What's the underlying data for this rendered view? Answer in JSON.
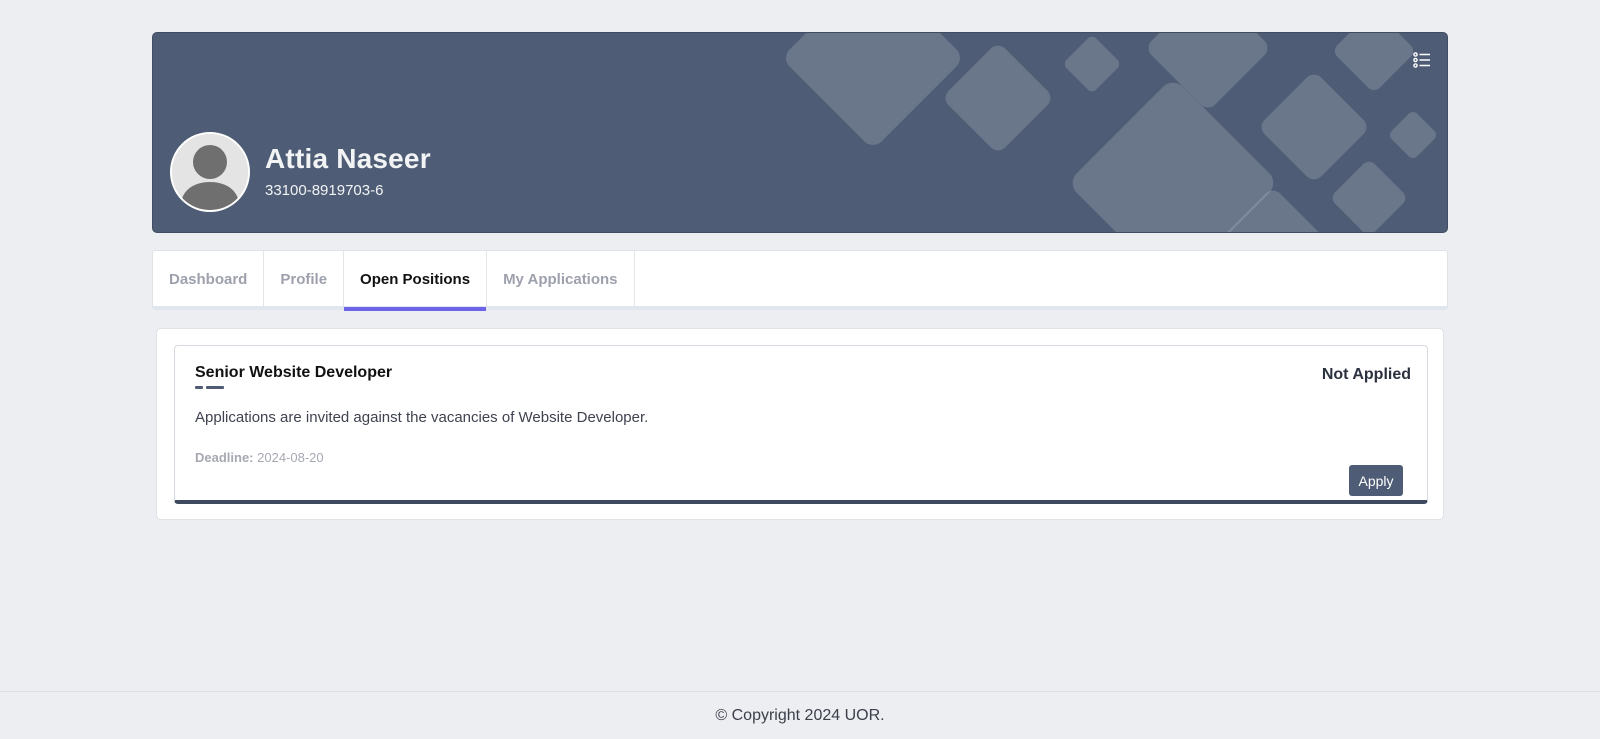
{
  "profile": {
    "name": "Attia Naseer",
    "id_number": "33100-8919703-6",
    "avatar_icon": "user-avatar-icon",
    "menu_icon": "list-menu-icon"
  },
  "tabs": [
    {
      "label": "Dashboard",
      "active": false
    },
    {
      "label": "Profile",
      "active": false
    },
    {
      "label": "Open Positions",
      "active": true
    },
    {
      "label": "My Applications",
      "active": false
    }
  ],
  "positions": [
    {
      "title": "Senior Website Developer",
      "status": "Not Applied",
      "description": "Applications are invited against the vacancies of Website Developer.",
      "deadline_label": "Deadline:",
      "deadline": "2024-08-20",
      "apply_label": "Apply"
    }
  ],
  "footer": {
    "copyright": "© Copyright 2024 UOR."
  },
  "colors": {
    "banner": "#4e5d75",
    "accent": "#6c63e8",
    "background": "#eceef1"
  }
}
